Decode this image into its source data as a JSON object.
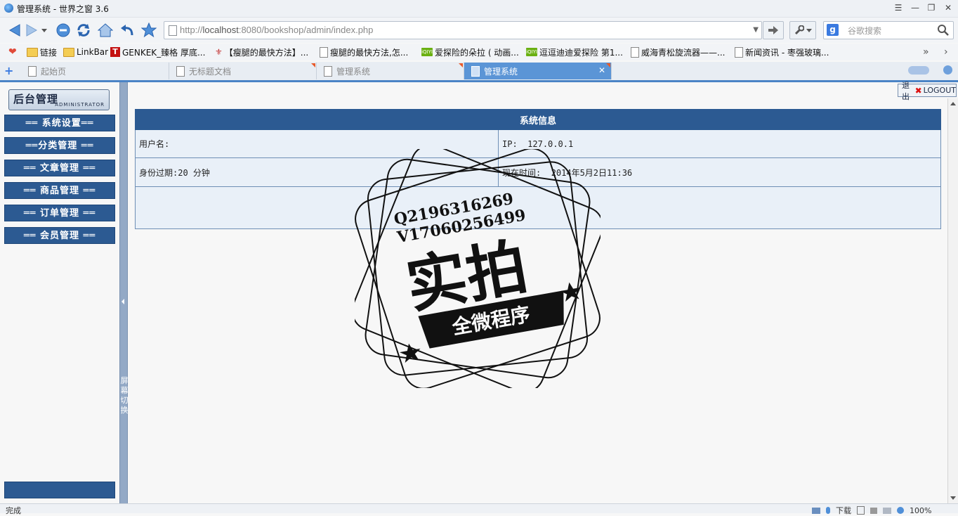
{
  "window": {
    "title": "管理系统 - 世界之窗 3.6",
    "controls": [
      "menu-icon",
      "minimize-icon",
      "restore-icon",
      "close-icon"
    ]
  },
  "navbar": {
    "url_prefix": "http://",
    "url_host": "localhost",
    "url_rest": ":8080/bookshop/admin/index.php",
    "search_placeholder": "谷歌搜索"
  },
  "bookmarks": [
    {
      "label": "链接",
      "icon": "folder-icon"
    },
    {
      "label": "LinkBar",
      "icon": "folder-icon"
    },
    {
      "label": "GENKEK_臻格 厚底...",
      "icon": "t-logo-icon"
    },
    {
      "label": "【瘦腿的最快方法】...",
      "icon": "site-icon"
    },
    {
      "label": "瘦腿的最快方法,怎...",
      "icon": "page-icon"
    },
    {
      "label": "爱探险的朵拉 ( 动画...",
      "icon": "iqiyi-icon"
    },
    {
      "label": "逗逗迪迪爱探险 第1...",
      "icon": "iqiyi-icon"
    },
    {
      "label": "威海青松旋流器——...",
      "icon": "page-icon"
    },
    {
      "label": "新闻资讯 - 枣强玻璃...",
      "icon": "page-icon"
    }
  ],
  "tabs": [
    {
      "label": "起始页",
      "active": false
    },
    {
      "label": "无标题文档",
      "active": false
    },
    {
      "label": "管理系统",
      "active": false
    },
    {
      "label": "管理系统",
      "active": true
    }
  ],
  "sidebar": {
    "logo_cn": "后台管理",
    "logo_en": "ADMINISTRATOR",
    "menu": [
      "══ 系统设置══",
      "══分类管理 ══",
      "══ 文章管理 ══",
      "══ 商品管理 ══",
      "══ 订单管理 ══",
      "══ 会员管理 ══"
    ]
  },
  "splitter": {
    "label": "屏幕切换"
  },
  "main": {
    "logout_cn": "退出",
    "logout_en": "LOGOUT",
    "table_title": "系统信息",
    "username_label": "用户名:",
    "ip_label": "IP:",
    "ip_value": "127.0.0.1",
    "session_label": "身份过期:",
    "session_value": "20 分钟",
    "time_label": "现在时间:",
    "time_value": "2014年5月2日11:36"
  },
  "watermark": {
    "line1": "Q2196316269",
    "line2": "V17060256499",
    "big": "实拍",
    "ribbon": "全微程序"
  },
  "statusbar": {
    "status": "完成",
    "download": "下载",
    "zoom": "100%"
  },
  "colors": {
    "menu_bg": "#2c5a92",
    "table_header": "#2c5a92",
    "table_cell": "#e9f0f8",
    "active_tab": "#5b95d6"
  }
}
